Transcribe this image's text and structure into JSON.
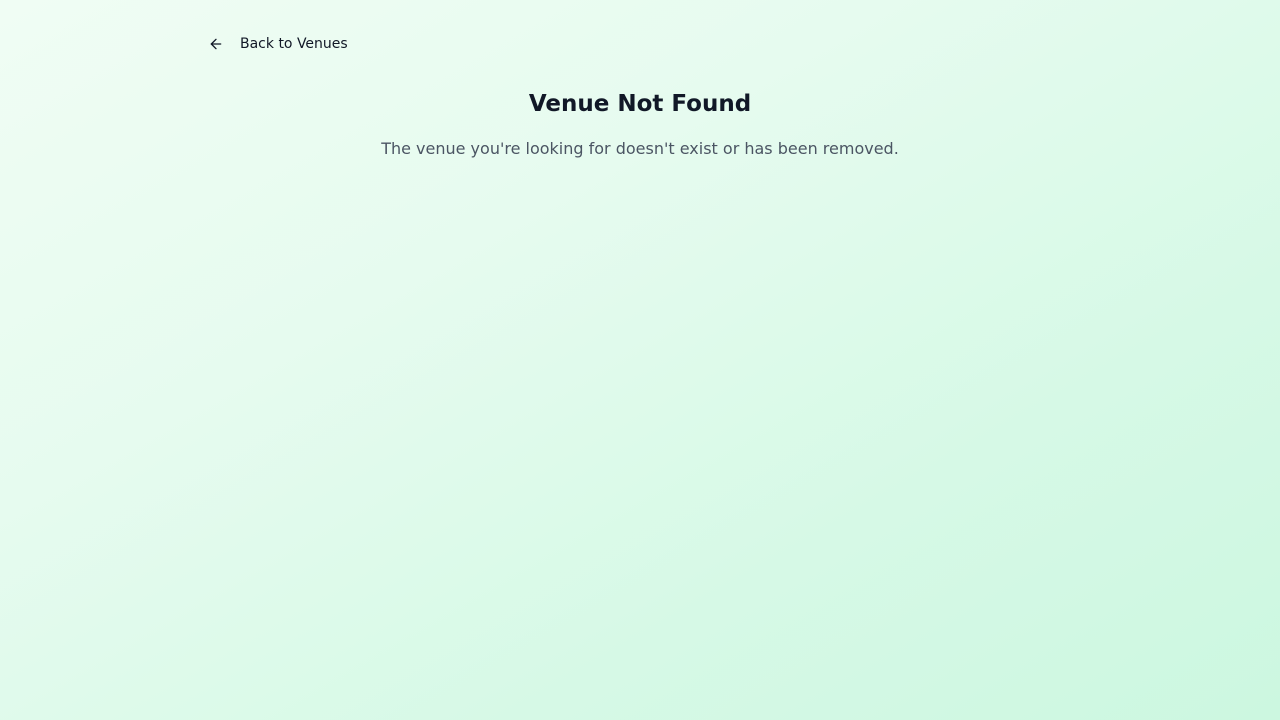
{
  "nav": {
    "back_label": "Back to Venues",
    "back_icon": "arrow-left-icon"
  },
  "error": {
    "title": "Venue Not Found",
    "message": "The venue you're looking for doesn't exist or has been removed."
  },
  "colors": {
    "background_start": "#f0fdf4",
    "background_end": "#ccf7e0",
    "title": "#111827",
    "message": "#4b5563"
  }
}
